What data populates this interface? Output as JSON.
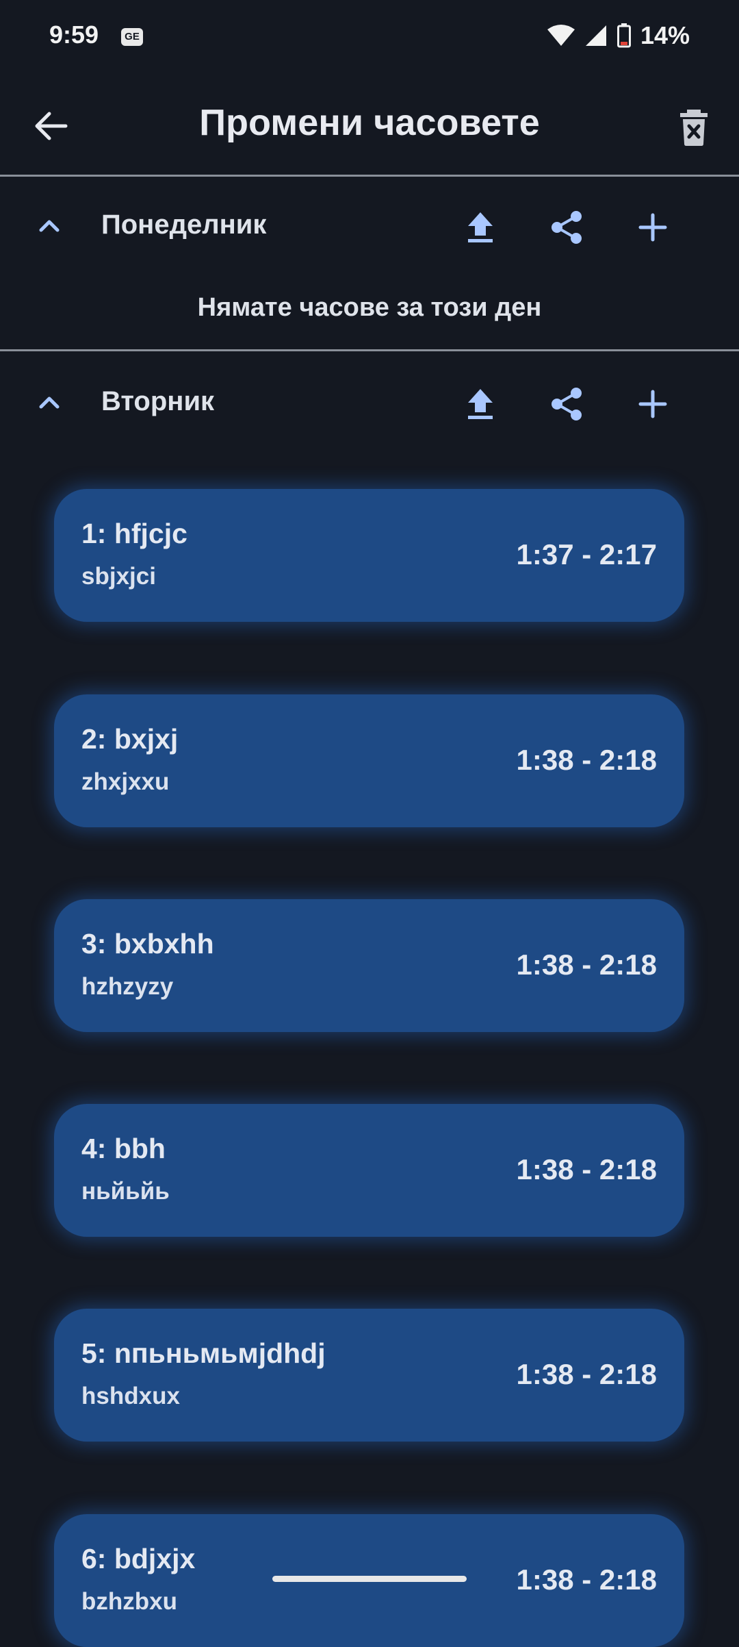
{
  "status_bar": {
    "time": "9:59",
    "badge": "GE",
    "battery": "14%"
  },
  "app_bar": {
    "title": "Промени часовете"
  },
  "sections": [
    {
      "day": "Понеделник",
      "empty_text": "Нямате часове за този ден"
    },
    {
      "day": "Вторник"
    }
  ],
  "lessons": [
    {
      "title": "1: hfjcjc",
      "subtitle": "sbjxjci",
      "time": "1:37 - 2:17"
    },
    {
      "title": "2: bxjxj",
      "subtitle": "zhxjxxu",
      "time": "1:38 - 2:18"
    },
    {
      "title": "3: bxbxhh",
      "subtitle": "hzhzyzy",
      "time": "1:38 - 2:18"
    },
    {
      "title": "4: bbh",
      "subtitle": "ньйьйь",
      "time": "1:38 - 2:18"
    },
    {
      "title": "5: nпьньмьмjdhdj",
      "subtitle": "hshdxux",
      "time": "1:38 - 2:18"
    },
    {
      "title": "6: bdjxjx",
      "subtitle": "bzhzbxu",
      "time": "1:38 - 2:18"
    }
  ],
  "colors": {
    "background": "#141821",
    "card": "#1e4a85",
    "accent": "#a9c7ff"
  },
  "icons": [
    "back-arrow-icon",
    "delete-icon",
    "chevron-up-icon",
    "upload-icon",
    "share-icon",
    "add-icon",
    "wifi-icon",
    "signal-icon",
    "battery-icon"
  ]
}
